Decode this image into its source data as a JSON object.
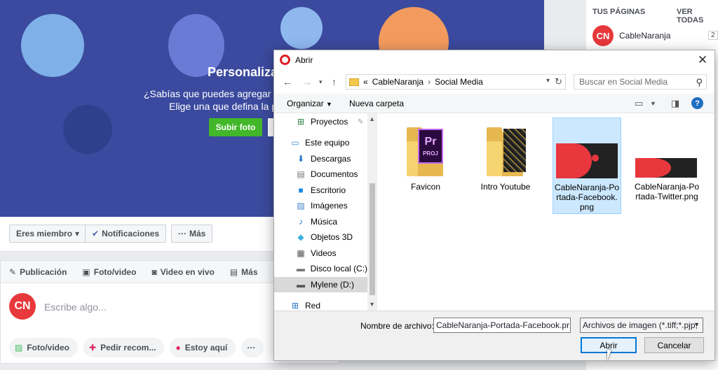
{
  "facebook": {
    "cover": {
      "title": "Personaliza",
      "subtitle_line1": "¿Sabías que puedes agregar u",
      "subtitle_line2": "Elige una que defina la p",
      "upload_button": "Subir foto"
    },
    "actions": {
      "member_button": "Eres miembro",
      "notifications_button": "Notificaciones",
      "more_button": "Más"
    },
    "composer": {
      "tabs": [
        "Publicación",
        "Foto/video",
        "Video en vivo",
        "Más"
      ],
      "placeholder": "Escribe algo...",
      "avatar_initials": "CN",
      "pills": [
        "Foto/video",
        "Pedir recom...",
        "Estoy aquí"
      ]
    },
    "right_panel": {
      "title": "TUS PÁGINAS",
      "see_all": "VER TODAS",
      "page_name": "CableNaranja",
      "page_avatar": "CN",
      "page_count": "2"
    }
  },
  "dialog": {
    "title": "Abrir",
    "close_icon": "close-icon",
    "breadcrumb": {
      "prefix": "«",
      "parts": [
        "CableNaranja",
        "Social Media"
      ]
    },
    "search_placeholder": "Buscar en Social Media",
    "toolbar": {
      "organize": "Organizar",
      "new_folder": "Nueva carpeta"
    },
    "nav_items": [
      {
        "label": "Proyectos",
        "icon": "network-icon"
      },
      {
        "label": "Este equipo",
        "icon": "computer-icon"
      },
      {
        "label": "Descargas",
        "icon": "download-icon"
      },
      {
        "label": "Documentos",
        "icon": "document-icon"
      },
      {
        "label": "Escritorio",
        "icon": "desktop-icon"
      },
      {
        "label": "Imágenes",
        "icon": "image-icon"
      },
      {
        "label": "Música",
        "icon": "music-icon"
      },
      {
        "label": "Objetos 3D",
        "icon": "cube-icon"
      },
      {
        "label": "Videos",
        "icon": "video-icon"
      },
      {
        "label": "Disco local (C:)",
        "icon": "drive-icon"
      },
      {
        "label": "Mylene (D:)",
        "icon": "drive-icon"
      },
      {
        "label": "Red",
        "icon": "network-icon"
      }
    ],
    "files": [
      {
        "label": "Favicon",
        "type": "folder"
      },
      {
        "label": "Intro Youtube",
        "type": "folder"
      },
      {
        "label": "CableNaranja-Portada-Facebook.png",
        "label_lines": [
          "CableNaranja-Po",
          "rtada-Facebook.",
          "png"
        ],
        "type": "image"
      },
      {
        "label": "CableNaranja-Portada-Twitter.png",
        "label_lines": [
          "CableNaranja-Po",
          "rtada-Twitter.png"
        ],
        "type": "image"
      }
    ],
    "file_name_label": "Nombre de archivo:",
    "file_name_value": "CableNaranja-Portada-Facebook.pr",
    "file_type_value": "Archivos de imagen (*.tiff;*.pjp,",
    "open_button": "Abrir",
    "cancel_button": "Cancelar"
  },
  "colors": {
    "facebook_blue": "#3b4a9e",
    "brand_red": "#e7383b",
    "selection_blue": "#cce8ff",
    "accent_blue": "#0078d7"
  }
}
